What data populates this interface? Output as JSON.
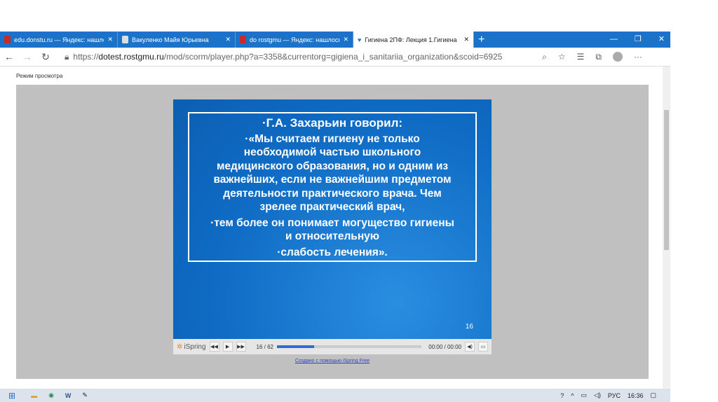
{
  "tabs": [
    {
      "title": "edu.donstu.ru — Яндекс: нашло"
    },
    {
      "title": "Вакуленко Майя Юрьевна"
    },
    {
      "title": "do rostgmu — Яндекс: нашлось"
    },
    {
      "title": "Гигиена 2ПФ: Лекция 1.Гигиена",
      "active": true
    }
  ],
  "address": {
    "prefix": "https://",
    "domain": "dotest.rostgmu.ru",
    "path": "/mod/scorm/player.php?a=3358&currentorg=gigiena_i_sanitariia_organization&scoid=6925"
  },
  "page": {
    "mode_label": "Режим просмотра"
  },
  "slide": {
    "lines": [
      "·Г.А. Захарьин говорил:",
      "·«Мы считаем гигиену не только",
      "необходимой частью школьного",
      "медицинского образования, но и одним из",
      "важнейших, если не важнейшим предметом",
      "деятельности практического врача. Чем",
      "зрелее практический врач,",
      "·тем более он понимает могущество гигиены",
      "и относительную",
      "·слабость лечения»."
    ],
    "number": "16"
  },
  "player": {
    "logo": "iSpring",
    "slide_counter": "16 / 62",
    "progress": 0.258,
    "time": "00:00 / 00:00",
    "credit_link": "Создано с помощью iSpring Free"
  },
  "taskbar": {
    "lang": "РУС",
    "time": "16:36"
  }
}
